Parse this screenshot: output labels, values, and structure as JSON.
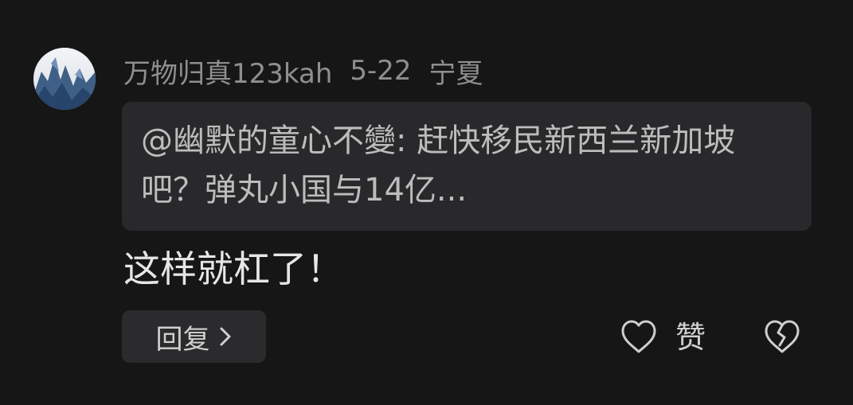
{
  "comment": {
    "username": "万物归真123kah",
    "date": "5-22",
    "location": "宁夏",
    "quoted_text": "@幽默的童心不變: 赶快移民新西兰新加坡吧？弹丸小国与14亿...",
    "body": "这样就杠了！",
    "reply_button_label": "回复",
    "like_label": "赞",
    "icons": {
      "avatar": "avatar",
      "reply_chevron": "chevron-right-icon",
      "like": "heart-icon",
      "dislike": "broken-heart-icon"
    }
  }
}
